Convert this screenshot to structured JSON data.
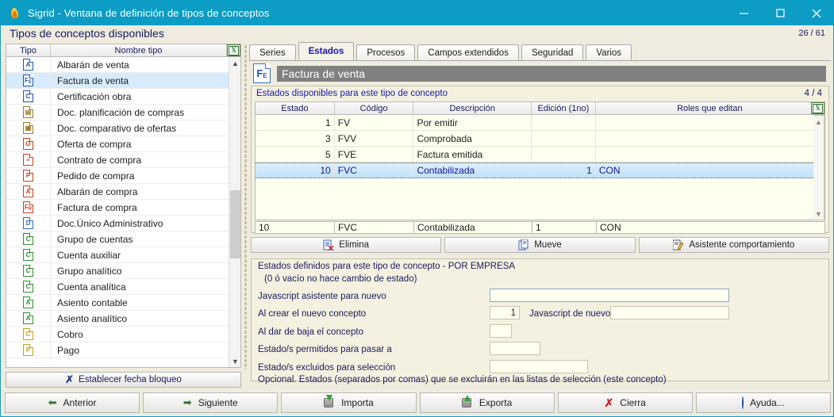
{
  "window": {
    "title": "Sigrid - Ventana de definición de tipos de conceptos",
    "minimize": "–",
    "maximize": "□",
    "close": "✕"
  },
  "header": {
    "title": "Tipos de conceptos disponibles",
    "counter": "26 / 61"
  },
  "sidebar": {
    "columns": [
      "Tipo",
      "Nombre tipo"
    ],
    "export_icon": "excel-icon",
    "items": [
      {
        "letter": "A",
        "sub": "",
        "color": "#1c52b8",
        "label": "Albarán de venta",
        "selected": false
      },
      {
        "letter": "F",
        "sub": "E",
        "color": "#1c52b8",
        "label": "Factura de venta",
        "selected": true
      },
      {
        "letter": "C",
        "sub": "",
        "color": "#1c52b8",
        "label": "Certificación obra",
        "selected": false
      },
      {
        "letter": "▤",
        "sub": "",
        "color": "#9a7b20",
        "label": "Doc. planificación de compras",
        "selected": false
      },
      {
        "letter": "▦",
        "sub": "",
        "color": "#9a7b20",
        "label": "Doc. comparativo de ofertas",
        "selected": false
      },
      {
        "letter": "O",
        "sub": "",
        "color": "#d23a16",
        "label": "Oferta de compra",
        "selected": false
      },
      {
        "letter": "≡",
        "sub": "",
        "color": "#d23a16",
        "label": "Contrato de compra",
        "selected": false
      },
      {
        "letter": "P",
        "sub": "",
        "color": "#d23a16",
        "label": "Pedido de compra",
        "selected": false
      },
      {
        "letter": "A",
        "sub": "",
        "color": "#d23a16",
        "label": "Albarán de compra",
        "selected": false
      },
      {
        "letter": "F",
        "sub": "R",
        "color": "#d23a16",
        "label": "Factura de compra",
        "selected": false
      },
      {
        "letter": "D",
        "sub": "",
        "color": "#2b6fb5",
        "label": "Doc.Único Administrativo",
        "selected": false
      },
      {
        "letter": "C",
        "sub": "",
        "color": "#2f8f2f",
        "label": "Grupo de cuentas",
        "selected": false
      },
      {
        "letter": "C",
        "sub": "",
        "color": "#2f8f2f",
        "label": "Cuenta auxiliar",
        "selected": false
      },
      {
        "letter": "C",
        "sub": "",
        "color": "#2f8f2f",
        "label": "Grupo analítico",
        "selected": false
      },
      {
        "letter": "C",
        "sub": "",
        "color": "#2f8f2f",
        "label": "Cuenta analítica",
        "selected": false
      },
      {
        "letter": "A",
        "sub": "",
        "color": "#2f8f2f",
        "label": "Asiento contable",
        "selected": false
      },
      {
        "letter": "A",
        "sub": "",
        "color": "#2f8f2f",
        "label": "Asiento analítico",
        "selected": false
      },
      {
        "letter": "C",
        "sub": "",
        "color": "#c9a400",
        "label": "Cobro",
        "selected": false
      },
      {
        "letter": "P",
        "sub": "",
        "color": "#c9a400",
        "label": "Pago",
        "selected": false
      }
    ],
    "block_date_button": "Establecer fecha bloqueo"
  },
  "tabs": [
    {
      "label": "Series",
      "active": false
    },
    {
      "label": "Estados",
      "active": true
    },
    {
      "label": "Procesos",
      "active": false
    },
    {
      "label": "Campos extendidos",
      "active": false
    },
    {
      "label": "Seguridad",
      "active": false
    },
    {
      "label": "Varios",
      "active": false
    }
  ],
  "concept": {
    "icon_letter": "F",
    "icon_sub": "E",
    "name": "Factura de venta"
  },
  "grid": {
    "title": "Estados disponibles para este tipo de concepto",
    "count": "4 / 4",
    "export_icon": "excel-icon",
    "columns": [
      "Estado",
      "Código",
      "Descripción",
      "Edición (1no)",
      "Roles que editan"
    ],
    "rows": [
      {
        "estado": "1",
        "codigo": "FV",
        "descripcion": "Por emitir",
        "edicion": "",
        "roles": "",
        "selected": false
      },
      {
        "estado": "3",
        "codigo": "FVV",
        "descripcion": "Comprobada",
        "edicion": "",
        "roles": "",
        "selected": false
      },
      {
        "estado": "5",
        "codigo": "FVE",
        "descripcion": "Factura emitida",
        "edicion": "",
        "roles": "",
        "selected": false
      },
      {
        "estado": "10",
        "codigo": "FVC",
        "descripcion": "Contabilizada",
        "edicion": "1",
        "roles": "CON",
        "selected": true
      }
    ],
    "edit_values": {
      "estado": "10",
      "codigo": "FVC",
      "descripcion": "Contabilizada",
      "edicion": "1",
      "roles": "CON"
    }
  },
  "actions": [
    {
      "label": "Elimina",
      "icon": "delete-list-icon"
    },
    {
      "label": "Mueve",
      "icon": "move-list-icon"
    },
    {
      "label": "Asistente comportamiento",
      "icon": "wizard-pencil-icon"
    }
  ],
  "form": {
    "heading": "Estados definidos para este tipo de concepto - POR EMPRESA",
    "subheading": "(0 ó vacío no hace cambio de estado)",
    "fields": [
      {
        "label": "Javascript asistente para nuevo",
        "value": ""
      },
      {
        "label": "Al crear el nuevo concepto",
        "value": "1"
      },
      {
        "label": "Javascript de nuevo",
        "value": ""
      },
      {
        "label": "Al dar de baja el concepto",
        "value": ""
      },
      {
        "label": "Estado/s permitidos para pasar a",
        "value": ""
      },
      {
        "label": "Estado/s excluidos para selección",
        "value": ""
      }
    ],
    "note": "Opcional. Estados (separados por comas) que se excluirán en las listas de selección (este concepto)"
  },
  "bottombar": [
    {
      "label": "Anterior",
      "icon": "arrow-left-icon"
    },
    {
      "label": "Siguiente",
      "icon": "arrow-right-icon"
    },
    {
      "label": "Importa",
      "icon": "import-icon"
    },
    {
      "label": "Exporta",
      "icon": "export-icon"
    },
    {
      "label": "Cierra",
      "icon": "close-x-icon"
    },
    {
      "label": "Ayuda...",
      "icon": "help-globe-icon"
    }
  ],
  "colors": {
    "titlebar": "#0c9cc4",
    "panel_bg": "#efecdf",
    "accent_link": "#1717c0",
    "selection": "#bfe2f8",
    "grid_bg": "#fffff0"
  }
}
